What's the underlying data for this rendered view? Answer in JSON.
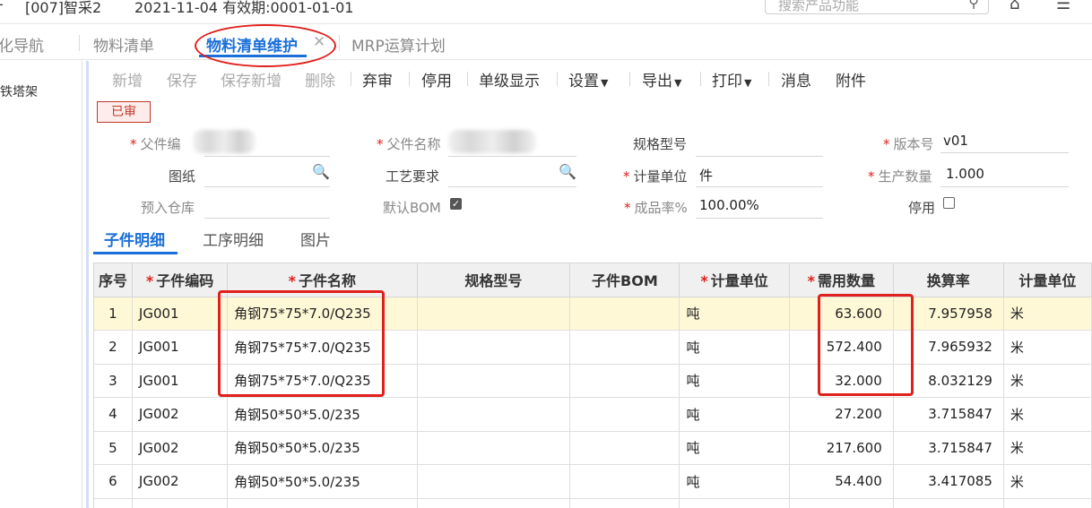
{
  "topbar": {
    "account": "[007]智采2",
    "date_info": "2021-11-04  有效期:0001-01-01",
    "search_placeholder": "搜索产品功能"
  },
  "tabs": [
    {
      "label": "化导航",
      "active": false
    },
    {
      "label": "物料清单",
      "active": false
    },
    {
      "label": "物料清单维护",
      "active": true
    },
    {
      "label": "MRP运算计划",
      "active": false
    }
  ],
  "close_glyph": "✕",
  "leftnav": {
    "item": "铁塔架"
  },
  "toolbar": {
    "new": "新增",
    "save": "保存",
    "save_new": "保存新增",
    "delete": "删除",
    "abandon": "弃审",
    "disable": "停用",
    "single_level": "单级显示",
    "settings": "设置",
    "export": "导出",
    "print": "打印",
    "message": "消息",
    "attachment": "附件"
  },
  "status": "已审",
  "form": {
    "parent_code_label": "父件编",
    "parent_name_label": "父件名称",
    "spec_label": "规格型号",
    "spec_value": "",
    "version_label": "版本号",
    "version_value": "v01",
    "drawing_label": "图纸",
    "process_label": "工艺要求",
    "unit_label": "计量单位",
    "unit_value": "件",
    "prod_qty_label": "生产数量",
    "prod_qty_value": "1.000",
    "warehouse_label": "预入仓库",
    "default_bom_label": "默认BOM",
    "default_bom_checked": true,
    "yield_label": "成品率%",
    "yield_value": "100.00%",
    "disabled_label": "停用",
    "disabled_checked": false
  },
  "subtabs": [
    "子件明细",
    "工序明细",
    "图片"
  ],
  "table": {
    "headers": [
      "序号",
      "子件编码",
      "子件名称",
      "规格型号",
      "子件BOM",
      "计量单位",
      "需用数量",
      "换算率",
      "计量单位"
    ],
    "rows": [
      {
        "no": "1",
        "code": "JG001",
        "name": "角钢75*75*7.0/Q235",
        "spec": "",
        "bom": "",
        "unit": "吨",
        "qty": "63.600",
        "rate": "7.957958",
        "unit2": "米"
      },
      {
        "no": "2",
        "code": "JG001",
        "name": "角钢75*75*7.0/Q235",
        "spec": "",
        "bom": "",
        "unit": "吨",
        "qty": "572.400",
        "rate": "7.965932",
        "unit2": "米"
      },
      {
        "no": "3",
        "code": "JG001",
        "name": "角钢75*75*7.0/Q235",
        "spec": "",
        "bom": "",
        "unit": "吨",
        "qty": "32.000",
        "rate": "8.032129",
        "unit2": "米"
      },
      {
        "no": "4",
        "code": "JG002",
        "name": "角钢50*50*5.0/235",
        "spec": "",
        "bom": "",
        "unit": "吨",
        "qty": "27.200",
        "rate": "3.715847",
        "unit2": "米"
      },
      {
        "no": "5",
        "code": "JG002",
        "name": "角钢50*50*5.0/235",
        "spec": "",
        "bom": "",
        "unit": "吨",
        "qty": "217.600",
        "rate": "3.715847",
        "unit2": "米"
      },
      {
        "no": "6",
        "code": "JG002",
        "name": "角钢50*50*5.0/235",
        "spec": "",
        "bom": "",
        "unit": "吨",
        "qty": "54.400",
        "rate": "3.417085",
        "unit2": "米"
      }
    ]
  },
  "colors": {
    "accent": "#1a6fd8",
    "highlight": "#e0201c",
    "selected_row": "#fff8d6"
  }
}
